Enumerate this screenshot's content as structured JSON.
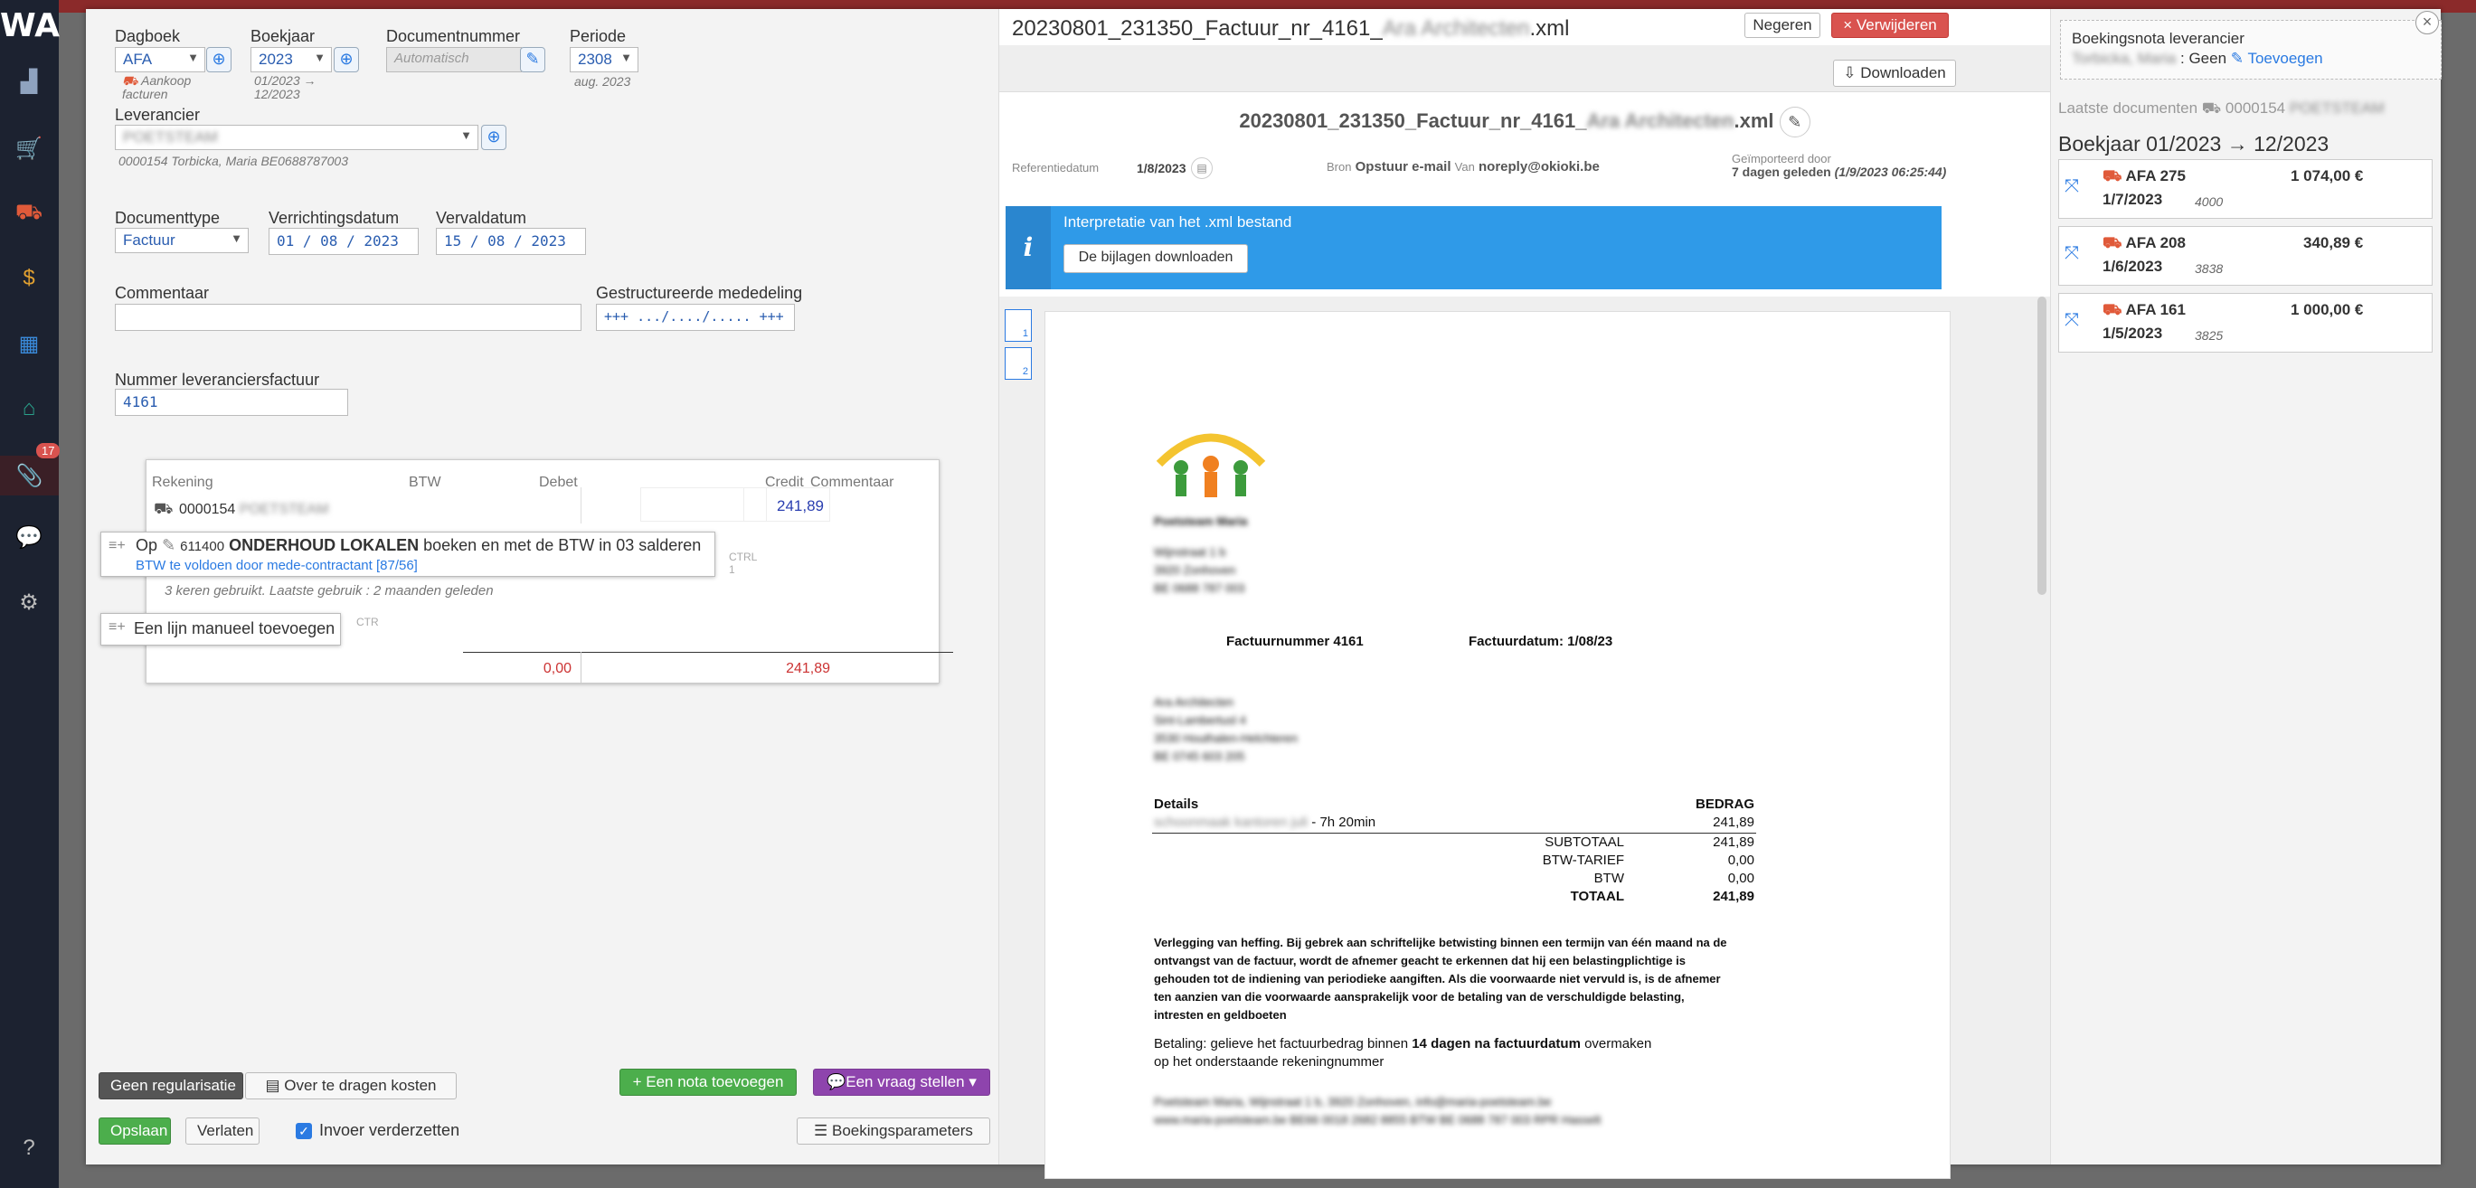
{
  "app": {
    "logo": "WA",
    "notification_count": "17",
    "nav_icons": [
      "chart-icon",
      "cart-icon",
      "truck-icon",
      "coin-icon",
      "dashboard-icon",
      "bank-icon",
      "paperclip-icon",
      "chat-icon",
      "gear-icon",
      "help-icon"
    ]
  },
  "form": {
    "dagboek_label": "Dagboek",
    "dagboek_value": "AFA",
    "dagboek_sub": "Aankoop facturen",
    "boekjaar_label": "Boekjaar",
    "boekjaar_value": "2023",
    "boekjaar_sub": "01/2023 → 12/2023",
    "documentnummer_label": "Documentnummer",
    "documentnummer_value": "Automatisch",
    "periode_label": "Periode",
    "periode_value": "2308",
    "periode_sub": "aug. 2023",
    "leverancier_label": "Leverancier",
    "leverancier_value": "POETSTEAM",
    "leverancier_sub": "0000154 Torbicka, Maria BE0688787003",
    "documenttype_label": "Documenttype",
    "documenttype_value": "Factuur",
    "verrichtingsdatum_label": "Verrichtingsdatum",
    "verrichtingsdatum_value": "01 / 08 / 2023",
    "vervaldatum_label": "Vervaldatum",
    "vervaldatum_value": "15 / 08 / 2023",
    "commentaar_label": "Commentaar",
    "commentaar_value": "",
    "gestructureerde_label": "Gestructureerde mededeling",
    "gestructureerde_value": "+++ .../..../..... +++",
    "nummer_label": "Nummer leveranciersfactuur",
    "nummer_value": "4161"
  },
  "booking_table": {
    "headers": [
      "Rekening",
      "BTW",
      "Debet",
      "Credit",
      "Commentaar"
    ],
    "row_account": "0000154",
    "row_account_name": "POETSTEAM",
    "row_credit": "241,89",
    "suggestion_prefix": "Op",
    "suggestion_code": "611400",
    "suggestion_name": "ONDERHOUD LOKALEN",
    "suggestion_suffix": "boeken en met de BTW in 03 salderen",
    "suggestion_sub": "BTW te voldoen door mede-contractant [87/56]",
    "suggestion_shortcut": "CTRL 1",
    "used_text": "3 keren gebruikt. Laatste gebruik : 2 maanden geleden",
    "manual_add": "Een lijn manueel toevoegen",
    "manual_shortcut": "CTR",
    "total_debet": "0,00",
    "total_credit": "241,89"
  },
  "bottom": {
    "geen_regularisatie": "Geen regularisatie",
    "over_te_dragen": "Over te dragen kosten",
    "nota_toevoegen": "Een nota toevoegen",
    "vraag_stellen": "Een vraag stellen",
    "opslaan": "Opslaan",
    "verlaten": "Verlaten",
    "invoer_verderzetten": "Invoer verderzetten",
    "boekingsparameters": "Boekingsparameters"
  },
  "document": {
    "file_title_prefix": "20230801_231350_Factuur_nr_4161_",
    "file_title_blur": "Ara Architecten",
    "file_title_ext": ".xml",
    "negeren": "Negeren",
    "verwijderen": "Verwijderen",
    "downloaden": "Downloaden",
    "referentiedatum_label": "Referentiedatum",
    "referentiedatum_value": "1/8/2023",
    "bron_label": "Bron",
    "bron_value": "Opstuur e-mail",
    "van_label": "Van",
    "van_value": "noreply@okioki.be",
    "geimporteerd_label": "Geïmporteerd door",
    "geimporteerd_value": "7 dagen geleden",
    "geimporteerd_time": "(1/9/2023 06:25:44)",
    "info_title": "Interpretatie van het .xml bestand",
    "info_button": "De bijlagen downloaden",
    "pages": [
      "1",
      "2"
    ]
  },
  "invoice": {
    "company": "Poetsteam Maria",
    "address": [
      "Wijnstraat 1 b",
      "3920 Zonhoven",
      "BE 0688 787 003"
    ],
    "factuurnummer": "Factuurnummer 4161",
    "factuurdatum": "Factuurdatum: 1/08/23",
    "client": [
      "Ara Architecten",
      "Sint-Lambertusl 4",
      "3530 Houthalen-Helchteren",
      "BE 0745 603 205"
    ],
    "details_label": "Details",
    "bedrag_label": "BEDRAG",
    "line_desc": "schoonmaak kantoren juli",
    "line_duration": "- 7h 20min",
    "line_amount": "241,89",
    "subtotaal_label": "SUBTOTAAL",
    "subtotaal": "241,89",
    "btw_tarief_label": "BTW-TARIEF",
    "btw_tarief": "0,00",
    "btw_label": "BTW",
    "btw": "0,00",
    "totaal_label": "TOTAAL",
    "totaal": "241,89",
    "legal_text": "Verlegging van heffing. Bij gebrek aan schriftelijke betwisting binnen een termijn van één maand na de ontvangst van de factuur, wordt de afnemer geacht te erkennen dat hij een belastingplichtige is gehouden tot de indiening van periodieke aangiften. Als die voorwaarde niet vervuld is, is de afnemer ten aanzien van die voorwaarde aansprakelijk voor de betaling van de verschuldigde belasting, intresten en geldboeten",
    "payment_pre": "Betaling: gelieve het factuurbedrag binnen",
    "payment_bold": "14 dagen na factuurdatum",
    "payment_post": "overmaken",
    "payment_line2": "op het onderstaande rekeningnummer",
    "footer1": "Poetsteam Maria, Wijnstraat 1 b, 3920 Zonhoven, info@maria-poetsteam.be",
    "footer2": "www.maria-poetsteam.be BE66 0018 2682 8855 BTW BE 0688 787 003 RPR Hasselt"
  },
  "right": {
    "boekingsnota_label": "Boekingsnota leverancier",
    "boekingsnota_name": "Torbicka, Maria",
    "boekingsnota_value": ": Geen",
    "toevoegen": "Toevoegen",
    "laatste_label": "Laatste documenten",
    "laatste_account": "0000154",
    "laatste_name": "POETSTEAM",
    "boekjaar_heading": "Boekjaar 01/2023 → 12/2023",
    "cards": [
      {
        "code": "AFA 275",
        "amount": "1 074,00 €",
        "date": "1/7/2023",
        "num": "4000"
      },
      {
        "code": "AFA 208",
        "amount": "340,89 €",
        "date": "1/6/2023",
        "num": "3838"
      },
      {
        "code": "AFA 161",
        "amount": "1 000,00 €",
        "date": "1/5/2023",
        "num": "3825"
      }
    ]
  },
  "colors": {
    "accent_blue": "#2f9ae8",
    "green": "#4cae4c",
    "purple": "#8e44ad",
    "red": "#d9534f",
    "sidebar": "#1c2230"
  }
}
